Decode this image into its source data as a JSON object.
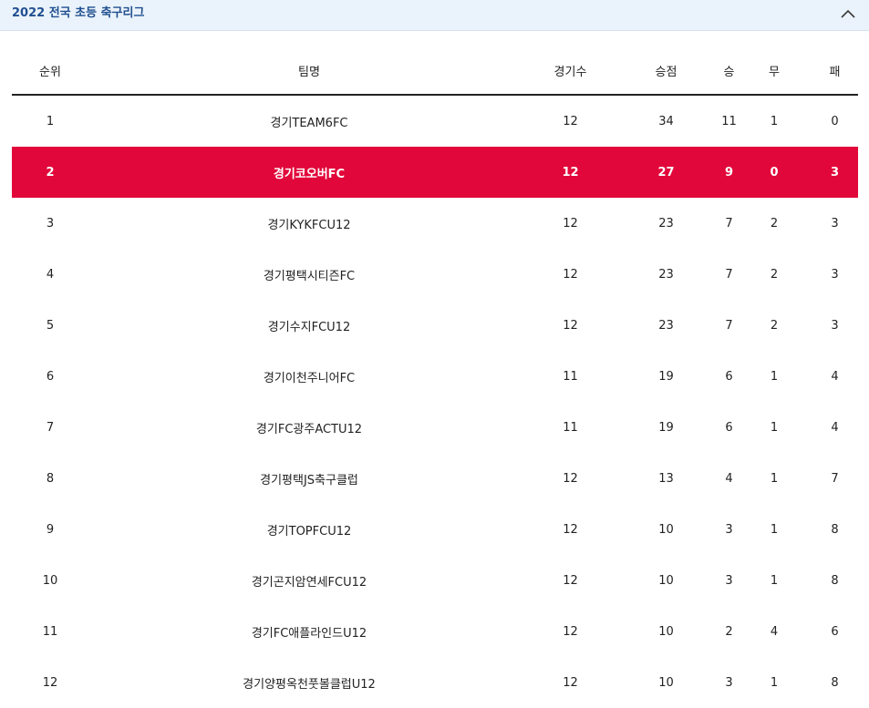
{
  "header": {
    "title": "2022 전국 초등 축구리그"
  },
  "table": {
    "columns": [
      "순위",
      "팀명",
      "경기수",
      "승점",
      "승",
      "무",
      "패"
    ],
    "rows": [
      {
        "rank": "1",
        "team": "경기TEAM6FC",
        "games": "12",
        "points": "34",
        "win": "11",
        "draw": "1",
        "loss": "0",
        "highlight": false
      },
      {
        "rank": "2",
        "team": "경기코오버FC",
        "games": "12",
        "points": "27",
        "win": "9",
        "draw": "0",
        "loss": "3",
        "highlight": true
      },
      {
        "rank": "3",
        "team": "경기KYKFCU12",
        "games": "12",
        "points": "23",
        "win": "7",
        "draw": "2",
        "loss": "3",
        "highlight": false
      },
      {
        "rank": "4",
        "team": "경기평택시티즌FC",
        "games": "12",
        "points": "23",
        "win": "7",
        "draw": "2",
        "loss": "3",
        "highlight": false
      },
      {
        "rank": "5",
        "team": "경기수지FCU12",
        "games": "12",
        "points": "23",
        "win": "7",
        "draw": "2",
        "loss": "3",
        "highlight": false
      },
      {
        "rank": "6",
        "team": "경기이천주니어FC",
        "games": "11",
        "points": "19",
        "win": "6",
        "draw": "1",
        "loss": "4",
        "highlight": false
      },
      {
        "rank": "7",
        "team": "경기FC광주ACTU12",
        "games": "11",
        "points": "19",
        "win": "6",
        "draw": "1",
        "loss": "4",
        "highlight": false
      },
      {
        "rank": "8",
        "team": "경기평택JS축구클럽",
        "games": "12",
        "points": "13",
        "win": "4",
        "draw": "1",
        "loss": "7",
        "highlight": false
      },
      {
        "rank": "9",
        "team": "경기TOPFCU12",
        "games": "12",
        "points": "10",
        "win": "3",
        "draw": "1",
        "loss": "8",
        "highlight": false
      },
      {
        "rank": "10",
        "team": "경기곤지암연세FCU12",
        "games": "12",
        "points": "10",
        "win": "3",
        "draw": "1",
        "loss": "8",
        "highlight": false
      },
      {
        "rank": "11",
        "team": "경기FC애플라인드U12",
        "games": "12",
        "points": "10",
        "win": "2",
        "draw": "4",
        "loss": "6",
        "highlight": false
      },
      {
        "rank": "12",
        "team": "경기양평옥천풋볼클럽U12",
        "games": "12",
        "points": "10",
        "win": "3",
        "draw": "1",
        "loss": "8",
        "highlight": false
      }
    ]
  },
  "colors": {
    "header_bg": "#eaf2fb",
    "title_color": "#1f4f8f",
    "highlight_row": "#e2073a"
  },
  "icons": {
    "toggle": "chevron-up-icon"
  }
}
